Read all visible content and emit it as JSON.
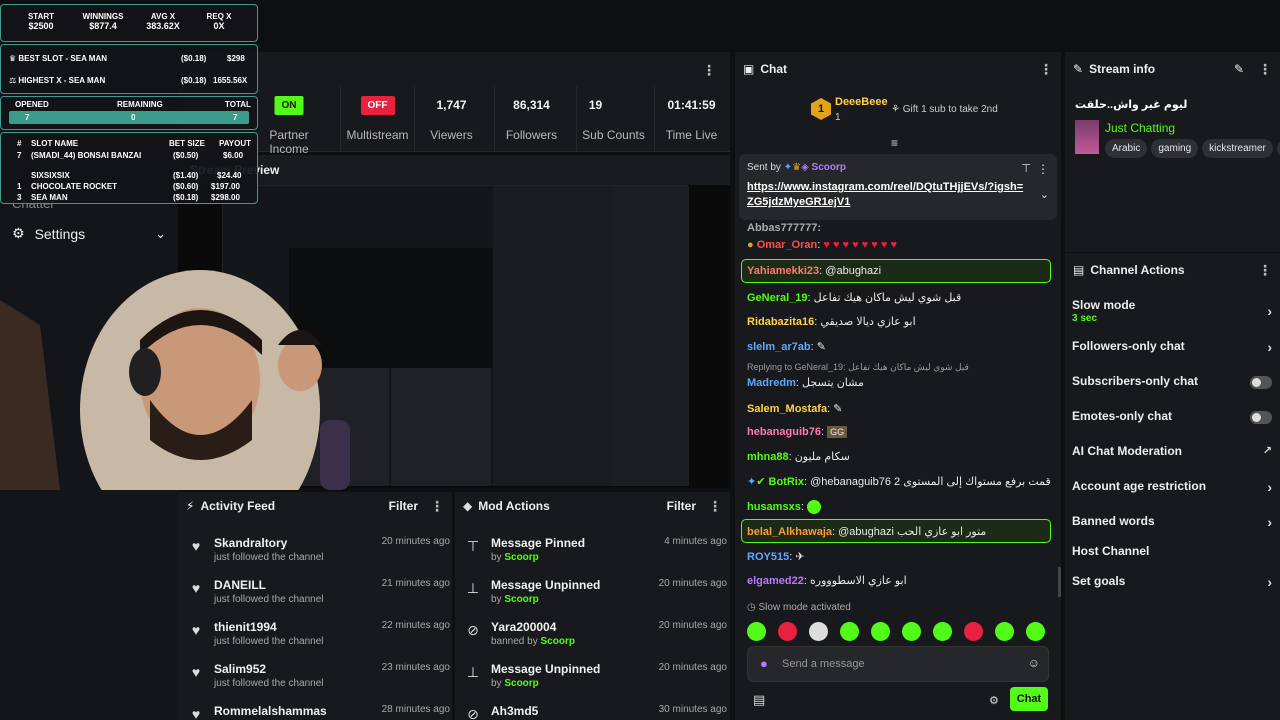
{
  "overlay": {
    "start_label": "START",
    "start_value": "$2500",
    "winnings_label": "WINNINGS",
    "winnings_value": "$877.4",
    "avg_label": "AVG X",
    "avg_value": "383.62x",
    "req_label": "REQ X",
    "req_value": "0x",
    "best_slot_label": "BEST SLOT - SEA MAN",
    "best_slot_bet": "($0.18)",
    "best_slot_pay": "$298",
    "highest_label": "HIGHEST X - SEA MAN",
    "highest_bet": "($0.18)",
    "highest_x": "1655.56x",
    "opened_label": "OPENED",
    "remaining_label": "REMAINING",
    "total_label": "TOTAL",
    "opened": "7",
    "remaining": "0",
    "total": "7",
    "col_num": "#",
    "col_slot": "SLOT NAME",
    "col_bet": "BET SIZE",
    "col_payout": "PAYOUT",
    "rows": [
      {
        "n": "7",
        "name": "(Smadi_44) BONSAI BANZAI",
        "bet": "($0.50)",
        "pay": "$6.00"
      },
      {
        "n": "",
        "name": "SIXSIXSIX",
        "bet": "($1.40)",
        "pay": "$24.40"
      },
      {
        "n": "1",
        "name": "CHOCOLATE ROCKET",
        "bet": "($0.60)",
        "pay": "$197.00"
      },
      {
        "n": "3",
        "name": "SEA MAN",
        "bet": "($0.18)",
        "pay": "$298.00"
      }
    ]
  },
  "nav": {
    "settings": "Settings",
    "hidden_item": "Chatter"
  },
  "stats": [
    {
      "pill": "ON",
      "label": "Partner Income"
    },
    {
      "pill": "OFF",
      "label": "Multistream"
    },
    {
      "value": "1,747",
      "label": "Viewers"
    },
    {
      "value": "86,314",
      "label": "Followers"
    },
    {
      "value": "19",
      "label": "Sub Counts"
    },
    {
      "value": "01:41:59",
      "label": "Time Live"
    }
  ],
  "video": {
    "title": "Stream Preview"
  },
  "activity": {
    "title": "Activity Feed",
    "filter": "Filter",
    "items": [
      {
        "name": "Skandraltory",
        "sub": "just followed the channel",
        "time": "20 minutes ago"
      },
      {
        "name": "DANEILL",
        "sub": "just followed the channel",
        "time": "21 minutes ago"
      },
      {
        "name": "thienit1994",
        "sub": "just followed the channel",
        "time": "22 minutes ago"
      },
      {
        "name": "Salim952",
        "sub": "just followed the channel",
        "time": "23 minutes ago"
      },
      {
        "name": "Rommelalshammas",
        "sub": "",
        "time": "28 minutes ago"
      }
    ]
  },
  "mod": {
    "title": "Mod Actions",
    "filter": "Filter",
    "items": [
      {
        "name": "Message Pinned",
        "by": "by",
        "who": "Scoorp",
        "time": "4 minutes ago",
        "icon": "pin-icon"
      },
      {
        "name": "Message Unpinned",
        "by": "by",
        "who": "Scoorp",
        "time": "20 minutes ago",
        "icon": "unpin-icon"
      },
      {
        "name": "Yara200004",
        "by": "banned by",
        "who": "Scoorp",
        "time": "20 minutes ago",
        "icon": "ban-icon"
      },
      {
        "name": "Message Unpinned",
        "by": "by",
        "who": "Scoorp",
        "time": "20 minutes ago",
        "icon": "unpin-icon"
      },
      {
        "name": "Ah3md5",
        "by": "",
        "who": "",
        "time": "30 minutes ago",
        "icon": "ban-icon"
      }
    ]
  },
  "chat": {
    "title": "Chat",
    "top_gifter": "DeeeBeee",
    "top_rank": "1",
    "top_count": "1",
    "gift_prompt": "Gift 1 sub to take 2nd",
    "pinned_sent_by": "Sent by",
    "pinned_user": "Scoorp",
    "pinned_link": "https://www.instagram.com/reel/DQtuTHjjEVs/?igsh=ZG5jdzMyeGR1ejV1",
    "partial_user": "Abbas777777:",
    "messages": [
      {
        "user": "Omar_Oran",
        "text": "♥ ♥ ♥ ♥ ♥ ♥ ♥ ♥",
        "color": "#ff4d4d"
      },
      {
        "user": "Yahiamekki23",
        "text": "@abughazi",
        "color": "#ff7a7a"
      },
      {
        "user": "GeNeral_19",
        "text": "قبل شوي ليش ماكان هيك تفاعل",
        "color": "#53fc18"
      },
      {
        "user": "Ridabazita16",
        "text": "ابو عازي ديالا صديقي",
        "color": "#ffd24d"
      },
      {
        "user": "slelm_ar7ab",
        "text": "",
        "color": "#5ea8ff"
      },
      {
        "user": "Madredm",
        "text": "مشان يتسجل",
        "color": "#5ea8ff"
      },
      {
        "user": "Salem_Mostafa",
        "text": "",
        "color": "#ffd24d"
      },
      {
        "user": "hebanaguib76",
        "text": "",
        "color": "#ff7ab6"
      },
      {
        "user": "mhna88",
        "text": "سكام مليون",
        "color": "#53fc18"
      },
      {
        "user": "BotRix",
        "text": "@hebanaguib76 قمت برفع مستواك إلى المستوى 2",
        "color": "#53fc18"
      },
      {
        "user": "husamsxs",
        "text": "",
        "color": "#53fc18"
      },
      {
        "user": "belal_Alkhawaja",
        "text": "@abughazi متور ابو عازي الحب",
        "color": "#ff9a3d"
      },
      {
        "user": "ROY515",
        "text": "",
        "color": "#5ea8ff"
      },
      {
        "user": "elgamed22",
        "text": "ابو عازي الاسطوووره",
        "color": "#b57aff"
      }
    ],
    "replying": "Replying to GeNeral_19: قبل شوي ليش ماكان هيك تفاعل",
    "slow_mode_notice": "Slow mode activated",
    "input_placeholder": "Send a message",
    "send_label": "Chat"
  },
  "stream_info": {
    "title": "Stream info",
    "stream_title": "ليوم غير واش..حلقت",
    "category": "Just Chatting",
    "tags": [
      "Arabic",
      "gaming",
      "kickstreamer",
      "a"
    ]
  },
  "channel_actions": {
    "title": "Channel Actions",
    "slow_mode": "Slow mode",
    "slow_mode_value": "3 sec",
    "followers_only": "Followers-only chat",
    "subscribers_only": "Subscribers-only chat",
    "emotes_only": "Emotes-only chat",
    "ai_moderation": "AI Chat Moderation",
    "age_restriction": "Account age restriction",
    "banned_words": "Banned words",
    "host_channel": "Host Channel",
    "set_goals": "Set goals"
  },
  "colors": {
    "accent": "#53fc18",
    "panel": "#18191c",
    "off": "#e8213f"
  }
}
